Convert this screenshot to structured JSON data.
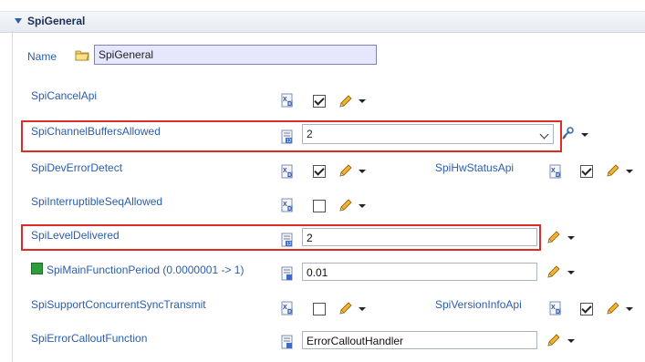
{
  "section": {
    "title": "SpiGeneral"
  },
  "name": {
    "label": "Name",
    "value": "SpiGeneral"
  },
  "rows": {
    "cancel_api": {
      "label": "SpiCancelApi",
      "checked": true
    },
    "channel_buffers": {
      "label": "SpiChannelBuffersAllowed",
      "value": "2"
    },
    "dev_error_detect": {
      "label": "SpiDevErrorDetect",
      "checked": true
    },
    "hw_status_api": {
      "label": "SpiHwStatusApi",
      "checked": true
    },
    "interruptible_seq": {
      "label": "SpiInterruptibleSeqAllowed",
      "checked": false
    },
    "level_delivered": {
      "label": "SpiLevelDelivered",
      "value": "2"
    },
    "main_function_period": {
      "label": "SpiMainFunctionPeriod (0.0000001 -> 1)",
      "value": "0.01"
    },
    "support_concurrent": {
      "label": "SpiSupportConcurrentSyncTransmit",
      "checked": false
    },
    "version_info_api": {
      "label": "SpiVersionInfoApi",
      "checked": true
    },
    "error_callout": {
      "label": "SpiErrorCalloutFunction",
      "value": "ErrorCalloutHandler"
    }
  },
  "icons": {
    "boolean": "boolean-param-icon",
    "integer": "integer-param-icon",
    "string": "string-param-icon",
    "folder": "folder-icon",
    "pencil": "edit-pencil-icon",
    "link": "reference-link-icon",
    "status": "status-green-icon"
  },
  "colors": {
    "label": "#2a5db0",
    "highlight": "#e02b2b",
    "name_box": "#e6e6ff"
  }
}
